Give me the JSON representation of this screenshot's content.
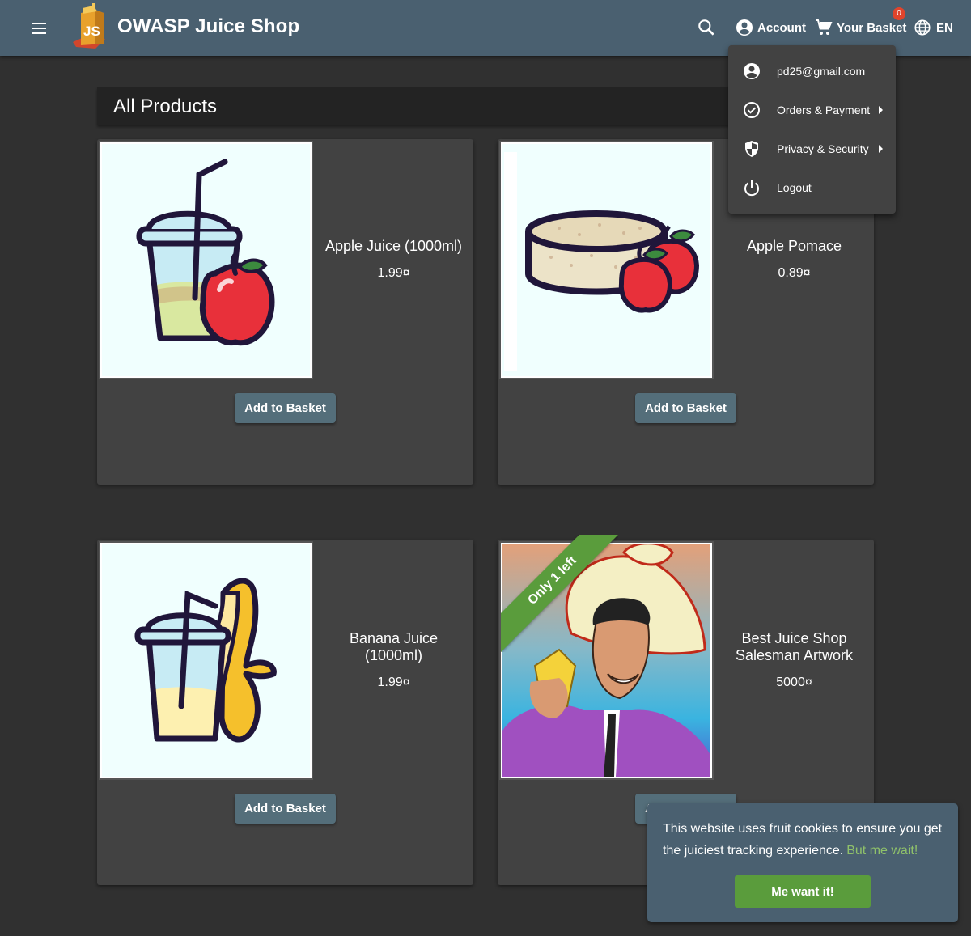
{
  "header": {
    "app_title": "OWASP Juice Shop",
    "account_label": "Account",
    "basket_label": "Your Basket",
    "basket_count": "0",
    "language_label": "EN"
  },
  "page": {
    "heading": "All Products"
  },
  "account_menu": {
    "items": [
      {
        "label": "pd25@gmail.com",
        "icon": "account-circle-icon"
      },
      {
        "label": "Orders & Payment",
        "icon": "check-circle-icon",
        "submenu": true
      },
      {
        "label": "Privacy & Security",
        "icon": "shield-icon",
        "submenu": true
      },
      {
        "label": "Logout",
        "icon": "power-icon"
      }
    ]
  },
  "products": [
    {
      "name": "Apple Juice (1000ml)",
      "price": "1.99¤",
      "button": "Add to Basket",
      "image": "apple-juice-illustration"
    },
    {
      "name": "Apple Pomace",
      "price": "0.89¤",
      "button": "Add to Basket",
      "image": "apple-pomace-illustration"
    },
    {
      "name": "Banana Juice (1000ml)",
      "price": "1.99¤",
      "button": "Add to Basket",
      "image": "banana-juice-illustration"
    },
    {
      "name": "Best Juice Shop Salesman Artwork",
      "price": "5000¤",
      "button": "Add to Basket",
      "image": "salesman-artwork",
      "ribbon": "Only 1 left"
    }
  ],
  "cookie_banner": {
    "message": "This website uses fruit cookies to ensure you get the juiciest tracking experience.",
    "link_text": "But me wait!",
    "accept_label": "Me want it!"
  },
  "colors": {
    "toolbar": "#4a6070",
    "background": "#303030",
    "card": "#424242",
    "button": "#546e7a",
    "accent_green": "#5a9c3c",
    "badge": "#e0442c"
  }
}
